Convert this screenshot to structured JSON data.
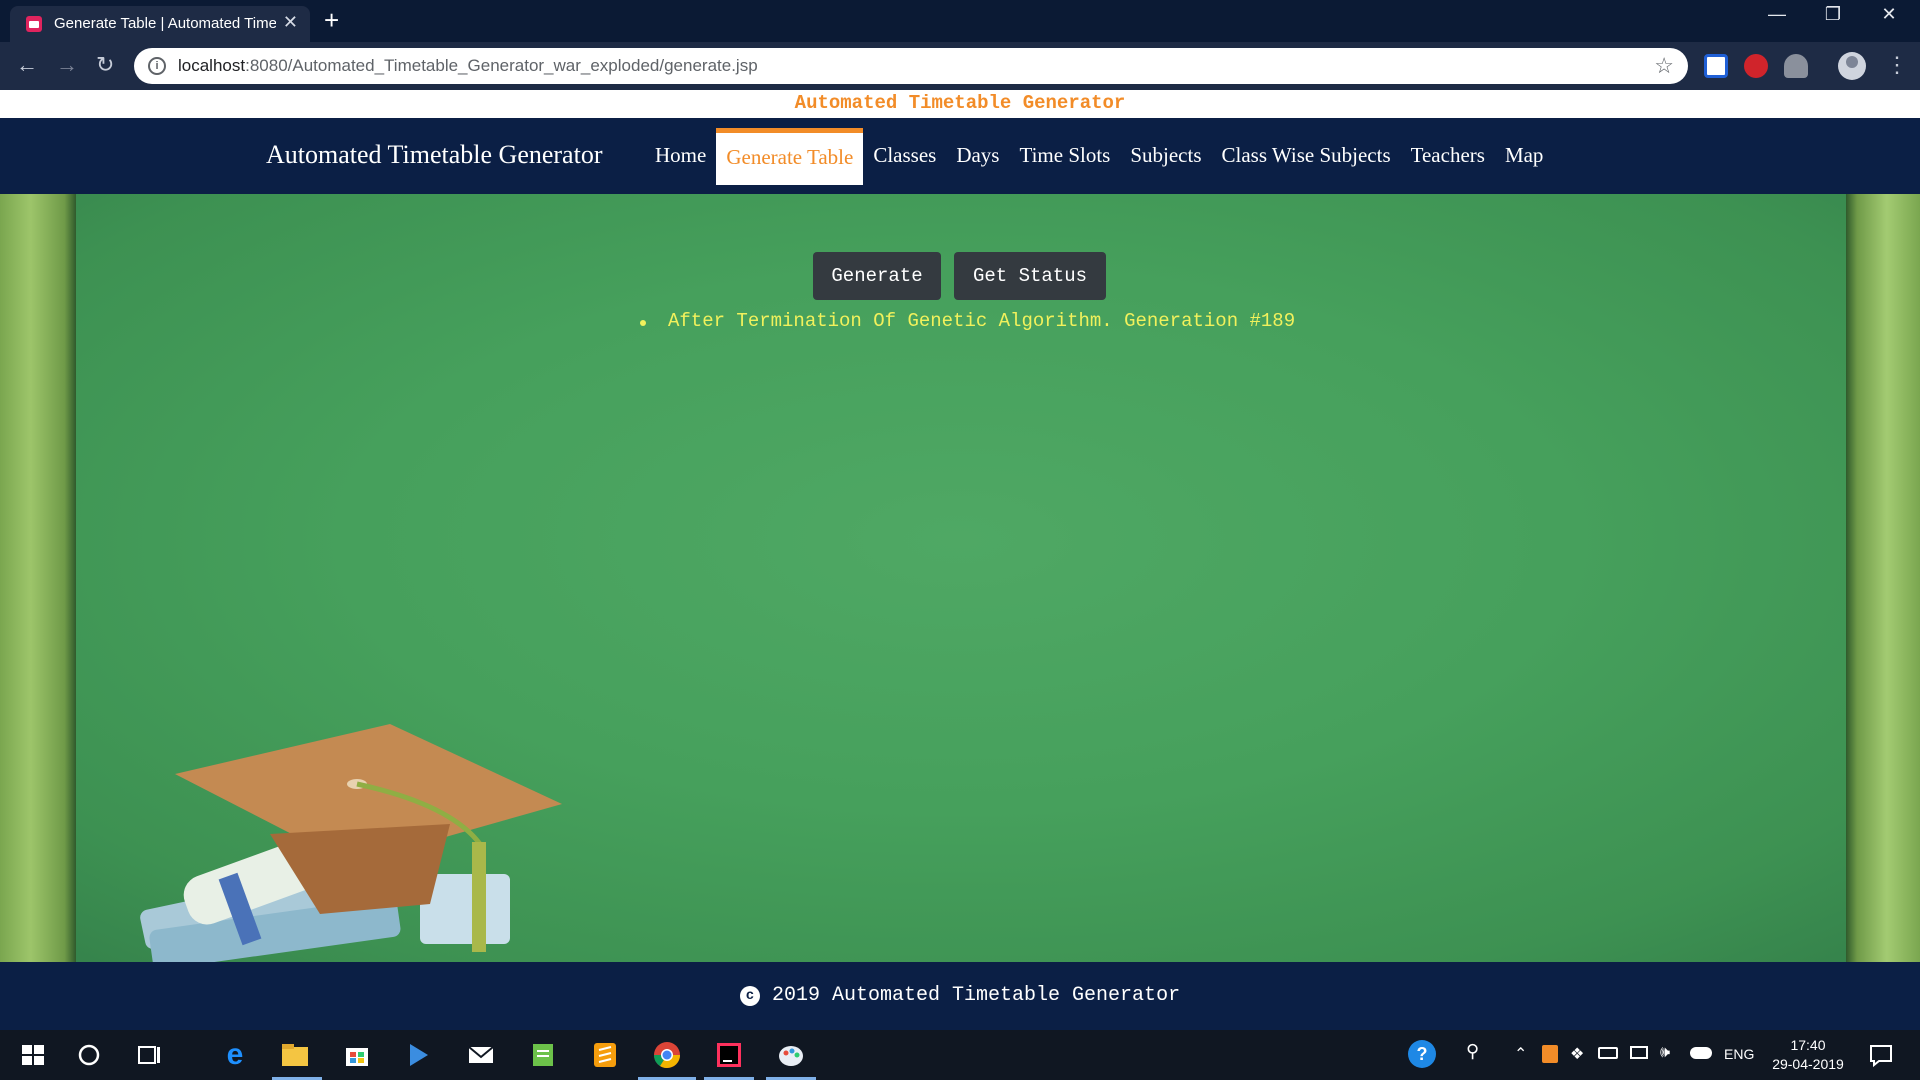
{
  "browser": {
    "tab_title": "Generate Table | Automated Timetable Generator",
    "url_host": "localhost",
    "url_rest": ":8080/Automated_Timetable_Generator_war_exploded/generate.jsp"
  },
  "page": {
    "marquee": "Automated Timetable Generator",
    "brand": "Automated Timetable Generator",
    "nav": [
      "Home",
      "Generate Table",
      "Classes",
      "Days",
      "Time Slots",
      "Subjects",
      "Class Wise Subjects",
      "Teachers",
      "Map"
    ],
    "active_nav": "Generate Table",
    "buttons": {
      "generate": "Generate",
      "get_status": "Get Status"
    },
    "status_items": [
      "After Termination Of Genetic Algorithm. Generation #189"
    ],
    "footer": "2019 Automated Timetable Generator"
  },
  "taskbar": {
    "language": "ENG",
    "time": "17:40",
    "date": "29-04-2019"
  },
  "colors": {
    "accent": "#f28c28",
    "navbar": "#0b1f45",
    "board": "#46a05c",
    "status_text": "#f1f15c"
  }
}
